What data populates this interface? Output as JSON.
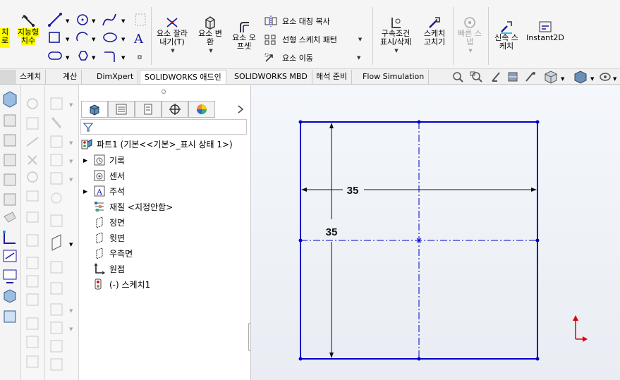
{
  "ribbon": {
    "smart_dim": {
      "line1": "지능형",
      "line2": "치수"
    },
    "left_cut": {
      "line1": "치",
      "line2": "로"
    },
    "trim": {
      "line1": "요소 잘라",
      "line2": "내기(T)"
    },
    "convert": {
      "line1": "요소 변",
      "line2": "환"
    },
    "offset": {
      "line1": "요소 오",
      "line2": "프셋"
    },
    "mirror": "요소 대칭 복사",
    "linear_pattern": "선형 스케치 패턴",
    "move": "요소 이동",
    "relations": {
      "line1": "구속조건",
      "line2": "표시/삭제"
    },
    "repair": {
      "line1": "스케치",
      "line2": "고치기"
    },
    "quick_snaps": {
      "line1": "빠른 스",
      "line2": "냅"
    },
    "rapid": {
      "line1": "신속 스",
      "line2": "케치"
    },
    "instant2d": "Instant2D"
  },
  "tabs": [
    "스케치",
    "계산",
    "DimXpert",
    "SOLIDWORKS 애드인",
    "SOLIDWORKS MBD",
    "해석 준비",
    "Flow Simulation"
  ],
  "active_tab": "SOLIDWORKS 애드인",
  "tree": {
    "root": "파트1  (기본<<기본>_표시 상태 1>)",
    "items": [
      "기록",
      "센서",
      "주석",
      "재질 <지정안함>",
      "정면",
      "윗면",
      "우측면",
      "원점",
      "(-) 스케치1"
    ]
  },
  "sketch": {
    "dim_horizontal": "35",
    "dim_vertical": "35"
  },
  "colors": {
    "sketch_blue": "#0000c8",
    "highlight_yellow": "#ffff00",
    "axis_red": "#e00000"
  }
}
